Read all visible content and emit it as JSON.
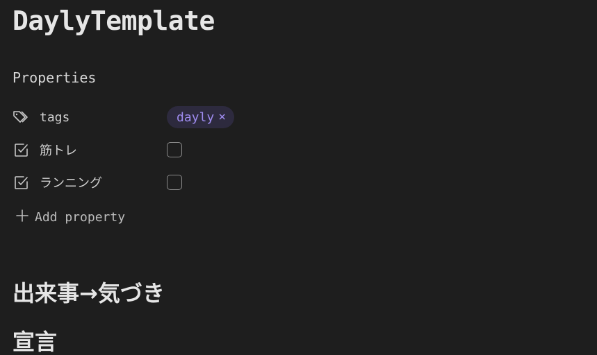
{
  "note": {
    "title": "DaylyTemplate"
  },
  "properties": {
    "heading": "Properties",
    "items": [
      {
        "icon": "tags-icon",
        "key": "tags",
        "type": "tags",
        "values": [
          "dayly"
        ]
      },
      {
        "icon": "checkbox-icon",
        "key": "筋トレ",
        "type": "checkbox",
        "checked": false
      },
      {
        "icon": "checkbox-icon",
        "key": "ランニング",
        "type": "checkbox",
        "checked": false
      }
    ],
    "add_label": "Add property"
  },
  "tag_remove_symbol": "×",
  "sections": [
    {
      "heading": "出来事→気づき"
    },
    {
      "heading": "宣言"
    }
  ],
  "colors": {
    "background": "#1e1e1e",
    "tag_bg": "#2d2a3e",
    "tag_text": "#9f8cf0"
  }
}
